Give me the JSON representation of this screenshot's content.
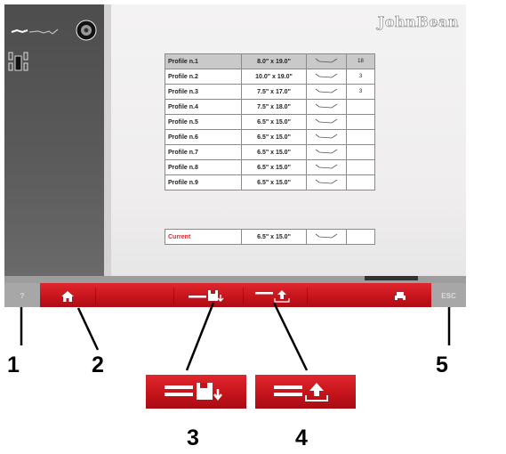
{
  "screen": {
    "logo": "JohnBean",
    "table": {
      "rows": [
        {
          "name": "Profile n.1",
          "size": "8.0\" x 19.0\"",
          "extra": "18",
          "selected": true
        },
        {
          "name": "Profile n.2",
          "size": "10.0\" x 19.0\"",
          "extra": "3"
        },
        {
          "name": "Profile n.3",
          "size": "7.5\" x 17.0\"",
          "extra": "3"
        },
        {
          "name": "Profile n.4",
          "size": "7.5\" x 18.0\"",
          "extra": ""
        },
        {
          "name": "Profile n.5",
          "size": "6.5\" x 15.0\"",
          "extra": ""
        },
        {
          "name": "Profile n.6",
          "size": "6.5\" x 15.0\"",
          "extra": ""
        },
        {
          "name": "Profile n.7",
          "size": "6.5\" x 15.0\"",
          "extra": ""
        },
        {
          "name": "Profile n.8",
          "size": "6.5\" x 15.0\"",
          "extra": ""
        },
        {
          "name": "Profile n.9",
          "size": "6.5\" x 15.0\"",
          "extra": ""
        }
      ],
      "current": {
        "name": "Current",
        "size": "6.5\" x 15.0\""
      }
    },
    "toolbar": {
      "help_label": "?",
      "exit_label": "ESC"
    }
  },
  "callouts": {
    "c1": "1",
    "c2": "2",
    "c3": "3",
    "c4": "4",
    "c5": "5"
  },
  "colors": {
    "accent_red": "#d11a22",
    "current_red": "#e3262b",
    "panel_dark": "#555555"
  }
}
